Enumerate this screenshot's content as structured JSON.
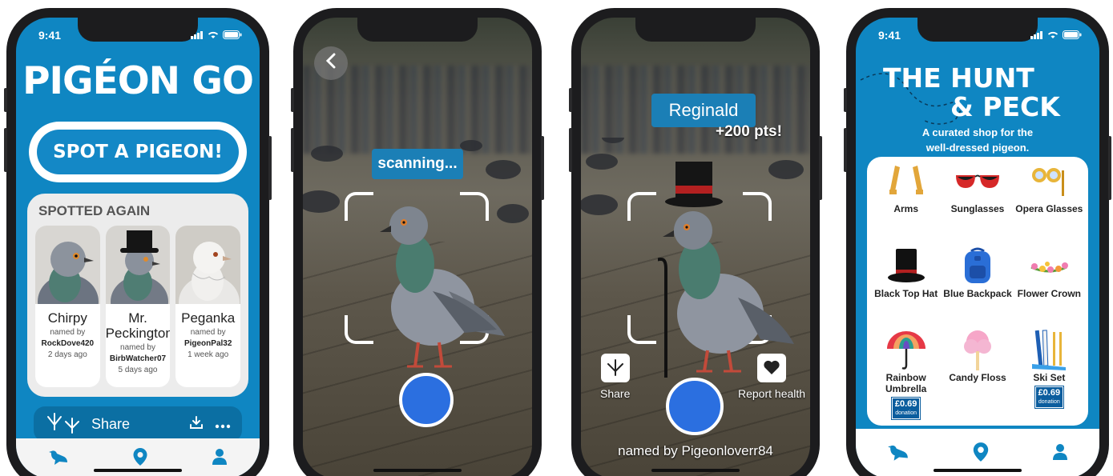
{
  "status": {
    "time": "9:41"
  },
  "home": {
    "title": "PIGÉON GO",
    "spot_button": "SPOT A PIGEON!",
    "spotted_title": "SPOTTED AGAIN",
    "cards": [
      {
        "name": "Chirpy",
        "named_by": "named by",
        "user": "RockDove420",
        "time": "2 days ago"
      },
      {
        "name": "Mr. Peckington",
        "named_by": "named by",
        "user": "BirbWatcher07",
        "time": "5 days ago"
      },
      {
        "name": "Peganka",
        "named_by": "named by",
        "user": "PigeonPal32",
        "time": "1 week ago"
      }
    ],
    "share_label": "Share"
  },
  "scan": {
    "scanning_label": "scanning..."
  },
  "result": {
    "pigeon_name": "Reginald",
    "points": "+200 pts!",
    "share_label": "Share",
    "report_label": "Report health",
    "named_by": "named by Pigeonloverr84"
  },
  "shop": {
    "title_line1": "THE HUNT",
    "title_line2": "& PECK",
    "subtitle_line1": "A curated shop for the",
    "subtitle_line2": "well-dressed pigeon.",
    "items": [
      {
        "name": "Arms",
        "price": "",
        "icon": "arms-icon"
      },
      {
        "name": "Sunglasses",
        "price": "",
        "icon": "sunglasses-icon"
      },
      {
        "name": "Opera Glasses",
        "price": "",
        "icon": "opera-glasses-icon"
      },
      {
        "name": "Black Top Hat",
        "price": "",
        "icon": "top-hat-icon"
      },
      {
        "name": "Blue Backpack",
        "price": "",
        "icon": "backpack-icon"
      },
      {
        "name": "Flower Crown",
        "price": "",
        "icon": "flower-crown-icon"
      },
      {
        "name": "Rainbow Umbrella",
        "price": "£0.69",
        "icon": "umbrella-icon"
      },
      {
        "name": "Candy Floss",
        "price": "",
        "icon": "candy-floss-icon"
      },
      {
        "name": "Ski Set",
        "price": "£0.69",
        "icon": "ski-set-icon"
      }
    ],
    "donation_label": "donation"
  },
  "colors": {
    "brand_blue": "#0f86c2",
    "button_blue": "#1488c6",
    "shutter_blue": "#2b6fe0"
  }
}
